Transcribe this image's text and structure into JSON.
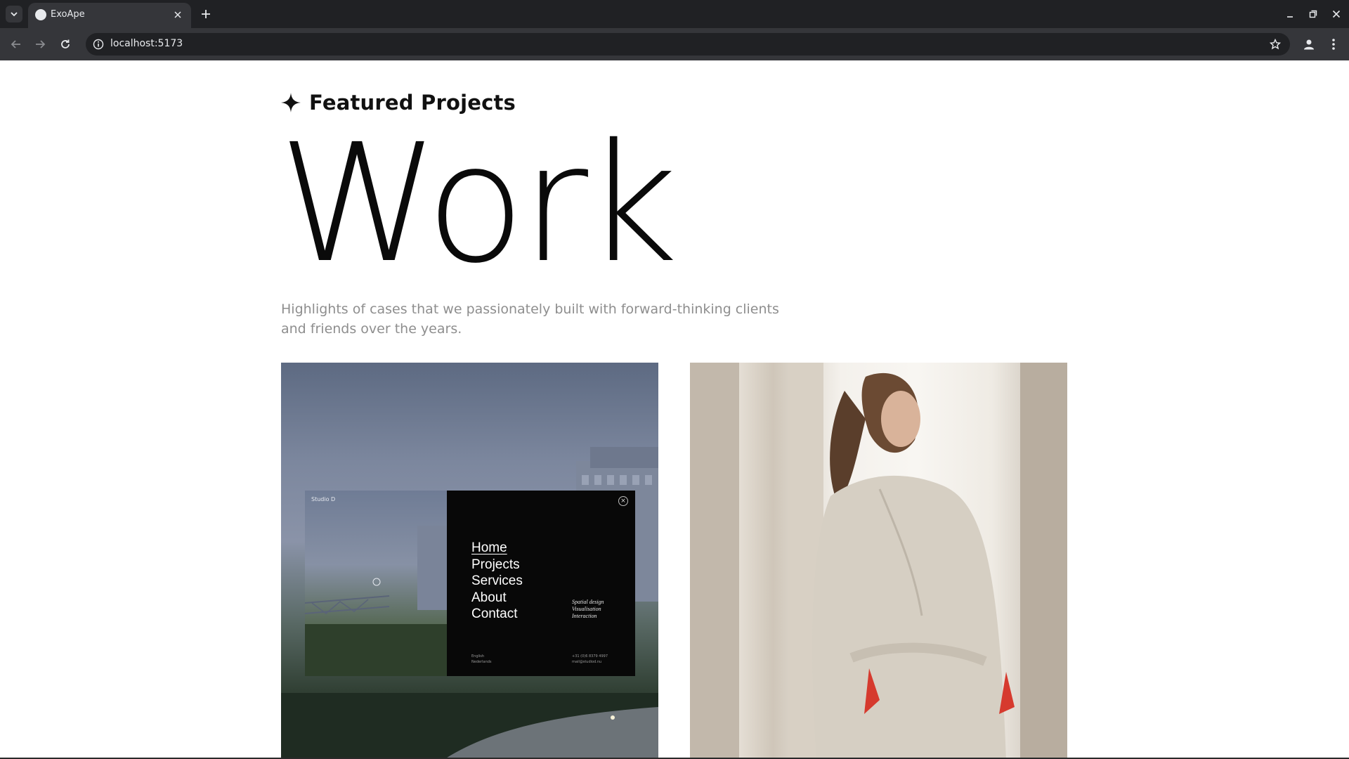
{
  "browser": {
    "tab_title": "ExoApe",
    "url": "localhost:5173",
    "icons": {
      "tab_list": "chevron-down-icon",
      "close_tab": "close-icon",
      "new_tab": "plus-icon",
      "back": "arrow-left-icon",
      "forward": "arrow-right-icon",
      "reload": "reload-icon",
      "site_info": "info-icon",
      "bookmark": "star-icon",
      "profile": "person-icon",
      "menu": "more-vertical-icon"
    }
  },
  "section": {
    "title": "Featured Projects",
    "icon": "sparkle-icon"
  },
  "hero": {
    "title": "Work"
  },
  "subtitle": "Highlights of cases that we passionately built with forward-thinking clients and friends over the years.",
  "projects": [
    {
      "image": "architecture-website-mockup",
      "overlay": {
        "brand": "Studio D",
        "menu": [
          "Home",
          "Projects",
          "Services",
          "About",
          "Contact"
        ],
        "tags": [
          "Spatial design",
          "Visualisation",
          "Interaction"
        ],
        "lang": [
          "English",
          "Nederlands"
        ],
        "contact": [
          "+31 (0)6 8379 4997",
          "mail@studiod.nu"
        ]
      }
    },
    {
      "image": "woman-in-trench-coat-photo"
    }
  ]
}
